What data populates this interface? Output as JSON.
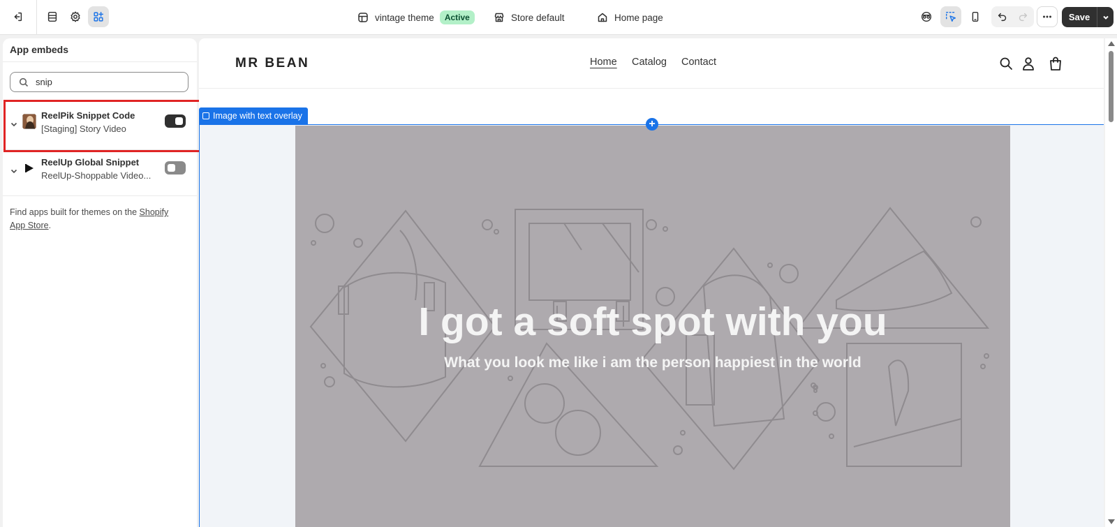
{
  "topbar": {
    "theme_name": "vintage theme",
    "theme_status": "Active",
    "store_context": "Store default",
    "page_context": "Home page",
    "save_label": "Save"
  },
  "sidebar": {
    "title": "App embeds",
    "search": {
      "value": "snip",
      "placeholder": ""
    },
    "embeds": [
      {
        "name": "ReelPik Snippet Code",
        "subtitle": "[Staging] Story Video",
        "enabled": true
      },
      {
        "name": "ReelUp Global Snippet",
        "subtitle": "ReelUp-Shoppable Video...",
        "enabled": false
      }
    ],
    "footer_text": "Find apps built for themes on the ",
    "footer_link": "Shopify App Store",
    "footer_end": "."
  },
  "preview": {
    "store_logo": "MR BEAN",
    "nav": [
      "Home",
      "Catalog",
      "Contact"
    ],
    "section_label": "Image with text overlay",
    "hero_title": "I got a soft spot with you",
    "hero_subtitle": "What you look me like i am the person happiest in the world"
  },
  "colors": {
    "accent": "#1a73e8",
    "highlight": "#e02424",
    "active_badge": "#b3f0c8",
    "hero_bg": "#aeaaae"
  }
}
